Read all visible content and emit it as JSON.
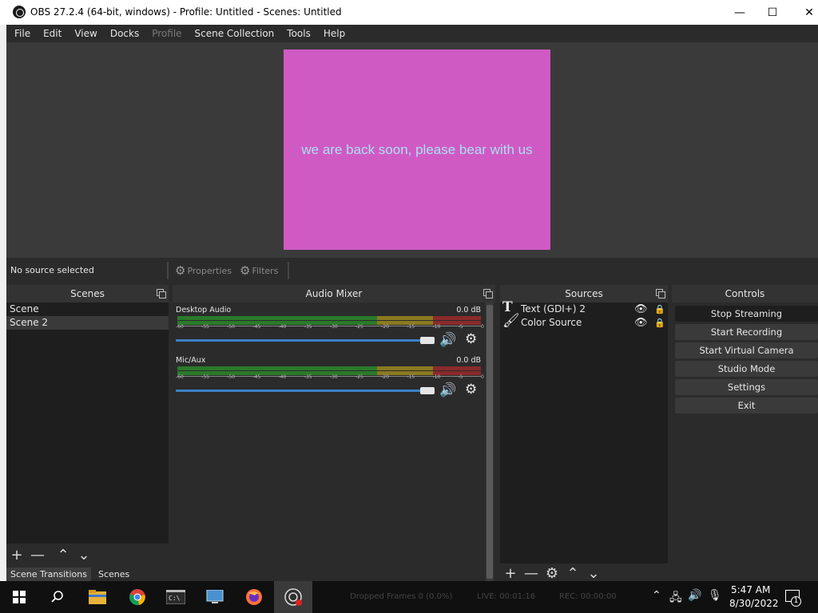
{
  "window": {
    "title": "OBS 27.2.4 (64-bit, windows) - Profile: Untitled - Scenes: Untitled",
    "minimize": "—",
    "maximize": "☐",
    "close": "✕"
  },
  "menu": [
    "File",
    "Edit",
    "View",
    "Docks",
    "Profile",
    "Scene Collection",
    "Tools",
    "Help"
  ],
  "preview": {
    "text": "we are back soon, please bear with us",
    "background": "#d05ac4"
  },
  "context": {
    "status": "No source selected",
    "properties": "Properties",
    "filters": "Filters"
  },
  "scenes": {
    "title": "Scenes",
    "items": [
      "Scene",
      "Scene 2"
    ],
    "selected_index": 1,
    "tabs": [
      "Scene Transitions",
      "Scenes"
    ]
  },
  "mixer": {
    "title": "Audio Mixer",
    "channels": [
      {
        "name": "Desktop Audio",
        "db": "0.0 dB"
      },
      {
        "name": "Mic/Aux",
        "db": "0.0 dB"
      }
    ],
    "tick_labels": [
      "-60",
      "-55",
      "-50",
      "-45",
      "-40",
      "-35",
      "-30",
      "-25",
      "-20",
      "-15",
      "-10",
      "-5",
      "0"
    ]
  },
  "sources": {
    "title": "Sources",
    "items": [
      {
        "label": "Text (GDI+) 2",
        "icon": "text-T-icon"
      },
      {
        "label": "Color Source",
        "icon": "brush-icon"
      }
    ]
  },
  "controls": {
    "title": "Controls",
    "buttons": [
      "Stop Streaming",
      "Start Recording",
      "Start Virtual Camera",
      "Studio Mode",
      "Settings",
      "Exit"
    ]
  },
  "taskbar": {
    "time": "5:47 AM",
    "date": "8/30/2022",
    "notification_count": "1",
    "status_dropped": "Dropped Frames 0 (0.0%)",
    "status_live": "LIVE: 00:01:16",
    "status_rec": "REC: 00:00:00"
  }
}
